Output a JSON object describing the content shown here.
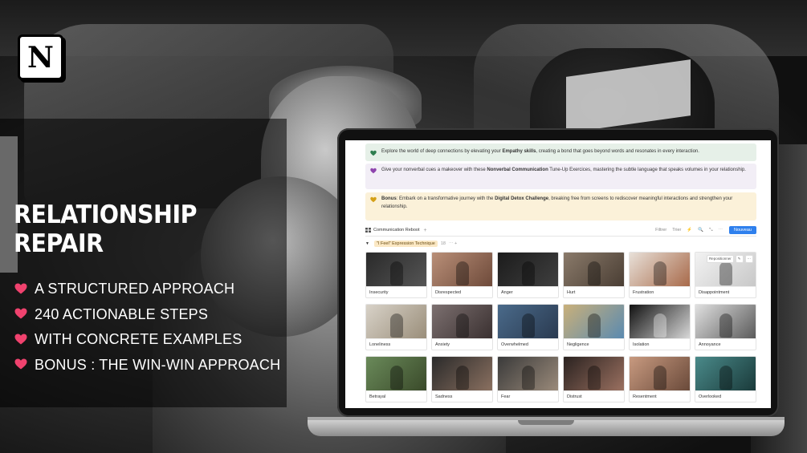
{
  "brand": {
    "logo_letter": "N",
    "icon": "notion-logo-icon"
  },
  "hero": {
    "title_line1": "RELATIONSHIP",
    "title_line2": "REPAIR",
    "features": [
      "A STRUCTURED APPROACH",
      "240 ACTIONABLE STEPS",
      "WITH CONCRETE EXAMPLES",
      "BONUS : THE WIN-WIN APPROACH"
    ],
    "bullet_icon": "heart-icon",
    "bullet_color": "#f0426e"
  },
  "screen": {
    "callouts": [
      {
        "icon": "green-heart-icon",
        "color": "#2e7d4f",
        "pre": "Explore the world of deep connections by elevating your ",
        "bold": "Empathy skills",
        "post": ", creating a bond that goes beyond words and resonates in every interaction."
      },
      {
        "icon": "purple-heart-icon",
        "color": "#8e44ad",
        "pre": "Give your nonverbal cues a makeover with these ",
        "bold": "Nonverbal Communication",
        "post": " Tune-Up Exercices, mastering the subtle language that speaks volumes in your relationship."
      },
      {
        "icon": "yellow-heart-icon",
        "color": "#d4a017",
        "lead": "Bonus",
        "pre": ": Embark on a transformative journey with the ",
        "bold": "Digital Detox Challenge",
        "post": ", breaking free from screens to rediscover meaningful interactions and strengthen your relationship."
      }
    ],
    "database": {
      "view_name": "Communication Reboot",
      "add": "+",
      "tools": [
        "Filtrer",
        "Trier",
        "⚡",
        "🔍",
        "⤡",
        "⋯"
      ],
      "new_button": "Nouveau"
    },
    "group": {
      "toggle": "▼",
      "tag": "\"I Feel\" Expression Technique",
      "count": "18",
      "more": "⋯ +"
    },
    "reposition": {
      "label": "Repositionner",
      "edit": "✎",
      "more": "⋯"
    },
    "cards": [
      {
        "label": "Insecurity",
        "tone": "#2a2a2a",
        "tone2": "#555555"
      },
      {
        "label": "Disrespected",
        "tone": "#b98f78",
        "tone2": "#6e4a3a"
      },
      {
        "label": "Anger",
        "tone": "#1c1c1c",
        "tone2": "#3f3f3f"
      },
      {
        "label": "Hurt",
        "tone": "#8a7a6a",
        "tone2": "#4a3e34"
      },
      {
        "label": "Frustration",
        "tone": "#e8e0d8",
        "tone2": "#a86a4a"
      },
      {
        "label": "Disappointment",
        "tone": "#f2f2f2",
        "tone2": "#c8c8c8"
      },
      {
        "label": "Loneliness",
        "tone": "#d8d2c8",
        "tone2": "#9a8e7a"
      },
      {
        "label": "Anxiety",
        "tone": "#7c7070",
        "tone2": "#3a3030"
      },
      {
        "label": "Overwhelmed",
        "tone": "#4a6a8a",
        "tone2": "#2a3a50"
      },
      {
        "label": "Negligence",
        "tone": "#c9b07a",
        "tone2": "#5a8ab0"
      },
      {
        "label": "Isolation",
        "tone": "#111111",
        "tone2": "#d8d8d8"
      },
      {
        "label": "Annoyance",
        "tone": "#e0e0e0",
        "tone2": "#5a5a5a"
      },
      {
        "label": "Betrayal",
        "tone": "#6a8a5a",
        "tone2": "#3a4a2a"
      },
      {
        "label": "Sadness",
        "tone": "#2a2a2a",
        "tone2": "#8a7060"
      },
      {
        "label": "Fear",
        "tone": "#3a3a3a",
        "tone2": "#9a8a7a"
      },
      {
        "label": "Distrust",
        "tone": "#2a2220",
        "tone2": "#9a7060"
      },
      {
        "label": "Resentment",
        "tone": "#c89a80",
        "tone2": "#6a4a3a"
      },
      {
        "label": "Overlooked",
        "tone": "#4a8a8a",
        "tone2": "#1a3a3a"
      }
    ]
  }
}
